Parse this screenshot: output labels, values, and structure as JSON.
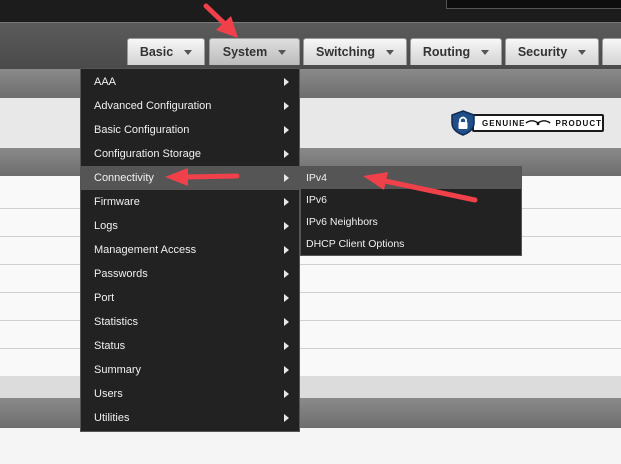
{
  "nav": {
    "tabs": [
      {
        "label": "Basic",
        "active": false
      },
      {
        "label": "System",
        "active": true
      },
      {
        "label": "Switching",
        "active": false
      },
      {
        "label": "Routing",
        "active": false
      },
      {
        "label": "Security",
        "active": false
      }
    ]
  },
  "badge": {
    "word1": "GENUINE",
    "word2": "PRODUCT",
    "icon": "lock-shield-icon"
  },
  "system_menu": {
    "items": [
      {
        "label": "AAA"
      },
      {
        "label": "Advanced Configuration"
      },
      {
        "label": "Basic Configuration"
      },
      {
        "label": "Configuration Storage"
      },
      {
        "label": "Connectivity",
        "highlighted": true
      },
      {
        "label": "Firmware"
      },
      {
        "label": "Logs"
      },
      {
        "label": "Management Access"
      },
      {
        "label": "Passwords"
      },
      {
        "label": "Port"
      },
      {
        "label": "Statistics"
      },
      {
        "label": "Status"
      },
      {
        "label": "Summary"
      },
      {
        "label": "Users"
      },
      {
        "label": "Utilities"
      }
    ]
  },
  "connectivity_submenu": {
    "items": [
      {
        "label": "IPv4",
        "highlighted": true
      },
      {
        "label": "IPv6"
      },
      {
        "label": "IPv6 Neighbors"
      },
      {
        "label": "DHCP Client Options"
      }
    ]
  },
  "colors": {
    "annotation_arrow": "#f0414a",
    "menu_bg": "#222222",
    "menu_highlight": "#555555"
  }
}
